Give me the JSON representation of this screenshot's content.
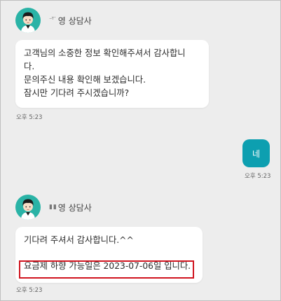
{
  "messages": [
    {
      "agent_name_masked": "⁻ᵀ˙",
      "agent_name": "영 상담사",
      "lines": [
        "고객님의 소중한 정보 확인해주셔서 감사합니",
        "다.",
        "문의주신 내용 확인해 보겠습니다.",
        "잠시만 기다려 주시겠습니까?"
      ],
      "time": "오후 5:23"
    },
    {
      "text": "네",
      "time": "오후 5:23"
    },
    {
      "agent_name_masked": "▮ ▮",
      "agent_name": "영 상담사",
      "lines": [
        "기다려 주셔서 감사합니다.^^",
        "",
        "요금제 하향 가능일은 2023-07-06일 입니다."
      ],
      "time": "오후 5:23"
    }
  ],
  "colors": {
    "background": "#ededed",
    "avatar": "#2ab3a6",
    "user_bubble": "#0d9fb0",
    "highlight": "#d0141f"
  },
  "icons": {
    "avatar": "agent-avatar-icon"
  }
}
